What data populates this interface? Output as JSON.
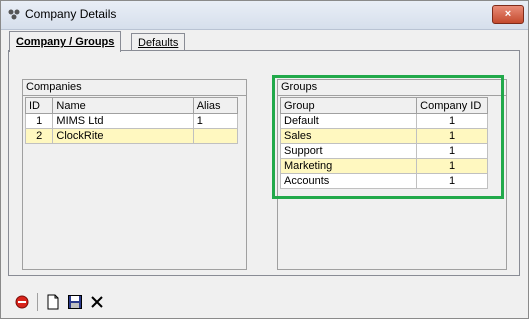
{
  "window": {
    "title": "Company Details",
    "close_label": "×"
  },
  "tabs": [
    {
      "label": "Company / Groups",
      "active": true
    },
    {
      "label": "Defaults",
      "active": false
    }
  ],
  "companies": {
    "title": "Companies",
    "columns": [
      "ID",
      "Name",
      "Alias"
    ],
    "rows": [
      {
        "id": "1",
        "name": "MIMS Ltd",
        "alias": "1",
        "highlight": false
      },
      {
        "id": "2",
        "name": "ClockRite",
        "alias": "",
        "highlight": true
      }
    ]
  },
  "groups": {
    "title": "Groups",
    "columns": [
      "Group",
      "Company ID"
    ],
    "rows": [
      {
        "group": "Default",
        "company_id": "1",
        "highlight": false
      },
      {
        "group": "Sales",
        "company_id": "1",
        "highlight": true
      },
      {
        "group": "Support",
        "company_id": "1",
        "highlight": false
      },
      {
        "group": "Marketing",
        "company_id": "1",
        "highlight": true
      },
      {
        "group": "Accounts",
        "company_id": "1",
        "highlight": false
      }
    ]
  },
  "toolbar": {
    "icons": [
      "stop-icon",
      "new-document-icon",
      "save-icon",
      "delete-icon"
    ]
  },
  "colors": {
    "highlight_row": "#fff8c0",
    "annotation_box": "#21a94a"
  }
}
